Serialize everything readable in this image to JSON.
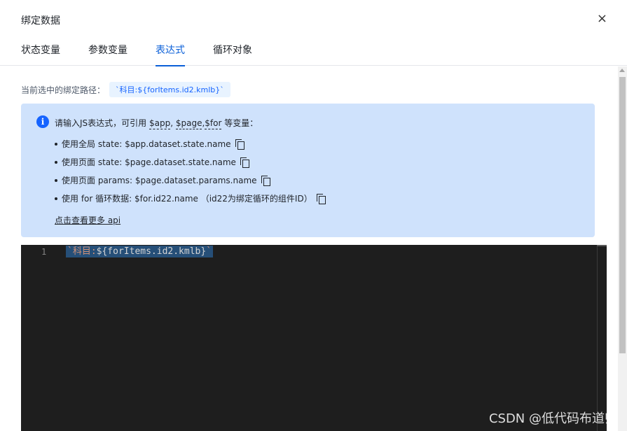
{
  "dialog": {
    "title": "绑定数据",
    "close_glyph": "×"
  },
  "tabs": [
    {
      "label": "状态变量",
      "active": false
    },
    {
      "label": "参数变量",
      "active": false
    },
    {
      "label": "表达式",
      "active": true
    },
    {
      "label": "循环对象",
      "active": false
    }
  ],
  "path": {
    "label": "当前选中的绑定路径：",
    "value": "`科目:${forItems.id2.kmlb}`"
  },
  "info": {
    "icon": "info-icon",
    "intro_prefix": "请输入JS表达式，可引用 ",
    "var_app": "$app",
    "sep1": ", ",
    "var_page": "$page",
    "sep2": ",",
    "var_for": "$for",
    "intro_suffix": " 等变量：",
    "bullets": [
      "使用全局 state: $app.dataset.state.name",
      "使用页面 state: $page.dataset.state.name",
      "使用页面 params: $page.dataset.params.name",
      "使用 for 循环数据: $for.id22.name （id22为绑定循环的组件ID）"
    ],
    "more_link": "点击查看更多 api"
  },
  "editor": {
    "line_number": "1",
    "code_backtick_open": "`",
    "code_string": "科目:",
    "code_expr": "${forItems.id2.kmlb}",
    "code_backtick_close": "`"
  },
  "watermark": "CSDN @低代码布道师",
  "colors": {
    "accent": "#0a5fd8",
    "info_bg": "#cfe2fc",
    "editor_bg": "#1e1e1e",
    "selection": "#264f78"
  }
}
